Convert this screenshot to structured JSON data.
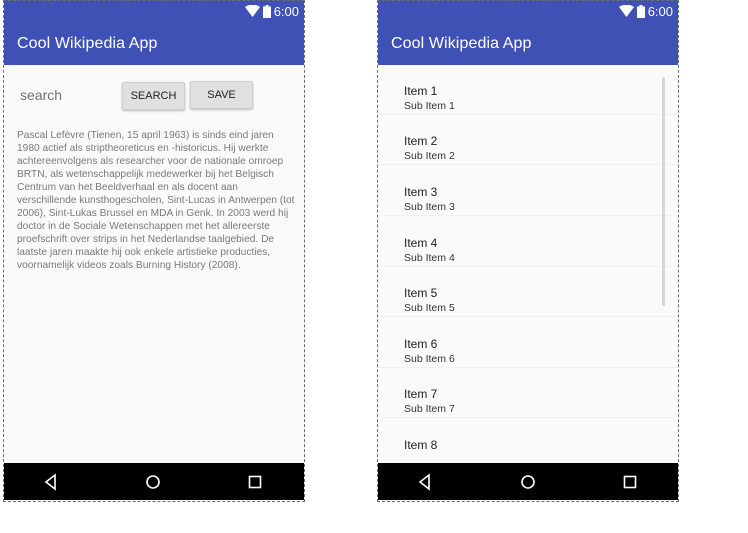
{
  "status": {
    "time": "6:00"
  },
  "app_title": "Cool Wikipedia App",
  "search": {
    "value": "search"
  },
  "buttons": {
    "search": "SEARCH",
    "save": "SAVE"
  },
  "article_text": "Pascal Lefèvre (Tienen, 15 april 1963) is sinds eind jaren 1980 actief als striptheoreticus en -historicus. Hij werkte achtereenvolgens als researcher voor de nationale omroep BRTN, als wetenschappelijk medewerker bij het Belgisch Centrum van het Beeldverhaal en als docent aan verschillende kunsthogescholen, Sint-Lucas in Antwerpen (tot 2006), Sint-Lukas Brussel en MDA in Genk. In 2003 werd hij doctor in de Sociale Wetenschappen met het allereerste proefschrift over strips in het Nederlandse taalgebied. De laatste jaren maakte hij ook enkele artistieke producties, voornamelijk videos zoals Burning History (2008).",
  "list_items": [
    {
      "title": "Item 1",
      "sub": "Sub Item 1"
    },
    {
      "title": "Item 2",
      "sub": "Sub Item 2"
    },
    {
      "title": "Item 3",
      "sub": "Sub Item 3"
    },
    {
      "title": "Item 4",
      "sub": "Sub Item 4"
    },
    {
      "title": "Item 5",
      "sub": "Sub Item 5"
    },
    {
      "title": "Item 6",
      "sub": "Sub Item 6"
    },
    {
      "title": "Item 7",
      "sub": "Sub Item 7"
    },
    {
      "title": "Item 8",
      "sub": ""
    }
  ],
  "icons": {
    "status": [
      "wifi-icon",
      "battery-icon"
    ],
    "nav": [
      "back-icon",
      "home-icon",
      "recents-icon"
    ]
  },
  "colors": {
    "primary": "#3f51b5",
    "navbar": "#000000",
    "background": "#fafafa"
  }
}
